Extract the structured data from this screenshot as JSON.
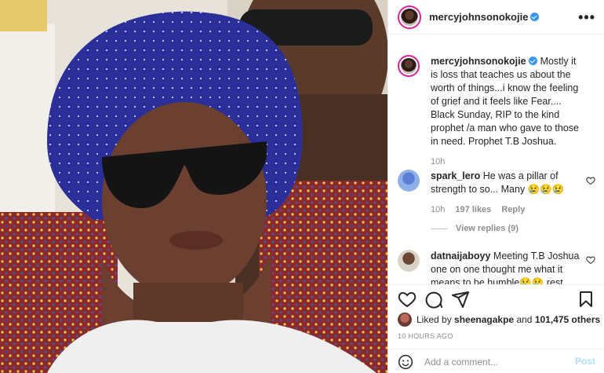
{
  "post": {
    "username": "mercyjohnsonokojie",
    "more_label": "•••"
  },
  "caption": {
    "username": "mercyjohnsonokojie",
    "text": "Mostly it is loss that teaches us about the worth of things...i know the feeling of grief and it feels like Fear.... Black Sunday, RIP to the kind prophet /a man who gave to those in need. Prophet T.B Joshua.",
    "time": "10h"
  },
  "comments": [
    {
      "username": "spark_lero",
      "text": "He was a pillar of strength to so... Many 😢😢😢",
      "time": "10h",
      "likes": "197 likes",
      "reply": "Reply",
      "view_replies": "View replies (9)"
    },
    {
      "username": "datnaijaboyy",
      "text": "Meeting T.B Joshua one on one thought me what it means to be humble😢😢 rest"
    }
  ],
  "likes": {
    "liked_by_prefix": "Liked by",
    "user": "sheenagakpe",
    "and_word": "and",
    "others": "101,475 others"
  },
  "timestamp": "10 HOURS AGO",
  "add_comment": {
    "placeholder": "Add a comment...",
    "post_label": "Post"
  },
  "colors": {
    "accent_blue": "#3897f0",
    "post_disabled": "#b2dffc",
    "ring": "#d6249f"
  },
  "icons": [
    "heart-icon",
    "comment-icon",
    "share-icon",
    "bookmark-icon",
    "emoji-icon",
    "verified-icon",
    "more-icon"
  ]
}
